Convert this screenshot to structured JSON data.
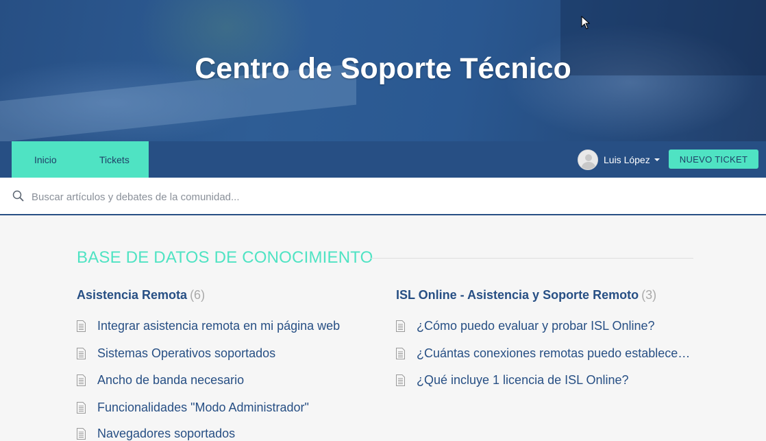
{
  "hero": {
    "title": "Centro de Soporte Técnico"
  },
  "nav": {
    "tabs": [
      {
        "label": "Inicio"
      },
      {
        "label": "Tickets"
      }
    ],
    "user_name": "Luis López",
    "new_ticket_label": "NUEVO TICKET"
  },
  "search": {
    "placeholder": "Buscar artículos y debates de la comunidad...",
    "value": ""
  },
  "knowledge_base": {
    "title": "BASE DE DATOS DE CONOCIMIENTO",
    "sections": [
      {
        "title": "Asistencia Remota",
        "count": "(6)",
        "articles": [
          "Integrar asistencia remota en mi página web",
          "Sistemas Operativos soportados",
          "Ancho de banda necesario",
          "Funcionalidades \"Modo Administrador\"",
          "Navegadores soportados"
        ]
      },
      {
        "title": "ISL Online - Asistencia y Soporte Remoto",
        "count": "(3)",
        "articles": [
          "¿Cómo puedo evaluar y probar ISL Online?",
          "¿Cuántas conexiones remotas puedo establecer con ISL Online?",
          "¿Qué incluye 1 licencia de ISL Online?"
        ]
      }
    ]
  },
  "colors": {
    "primary": "#274f84",
    "accent": "#4fe3c3",
    "background": "#f6f6f6"
  },
  "icons": {
    "search": "search-icon",
    "document": "document-icon",
    "avatar": "avatar-icon",
    "caret": "caret-down-icon",
    "cursor": "mouse-cursor-icon"
  }
}
